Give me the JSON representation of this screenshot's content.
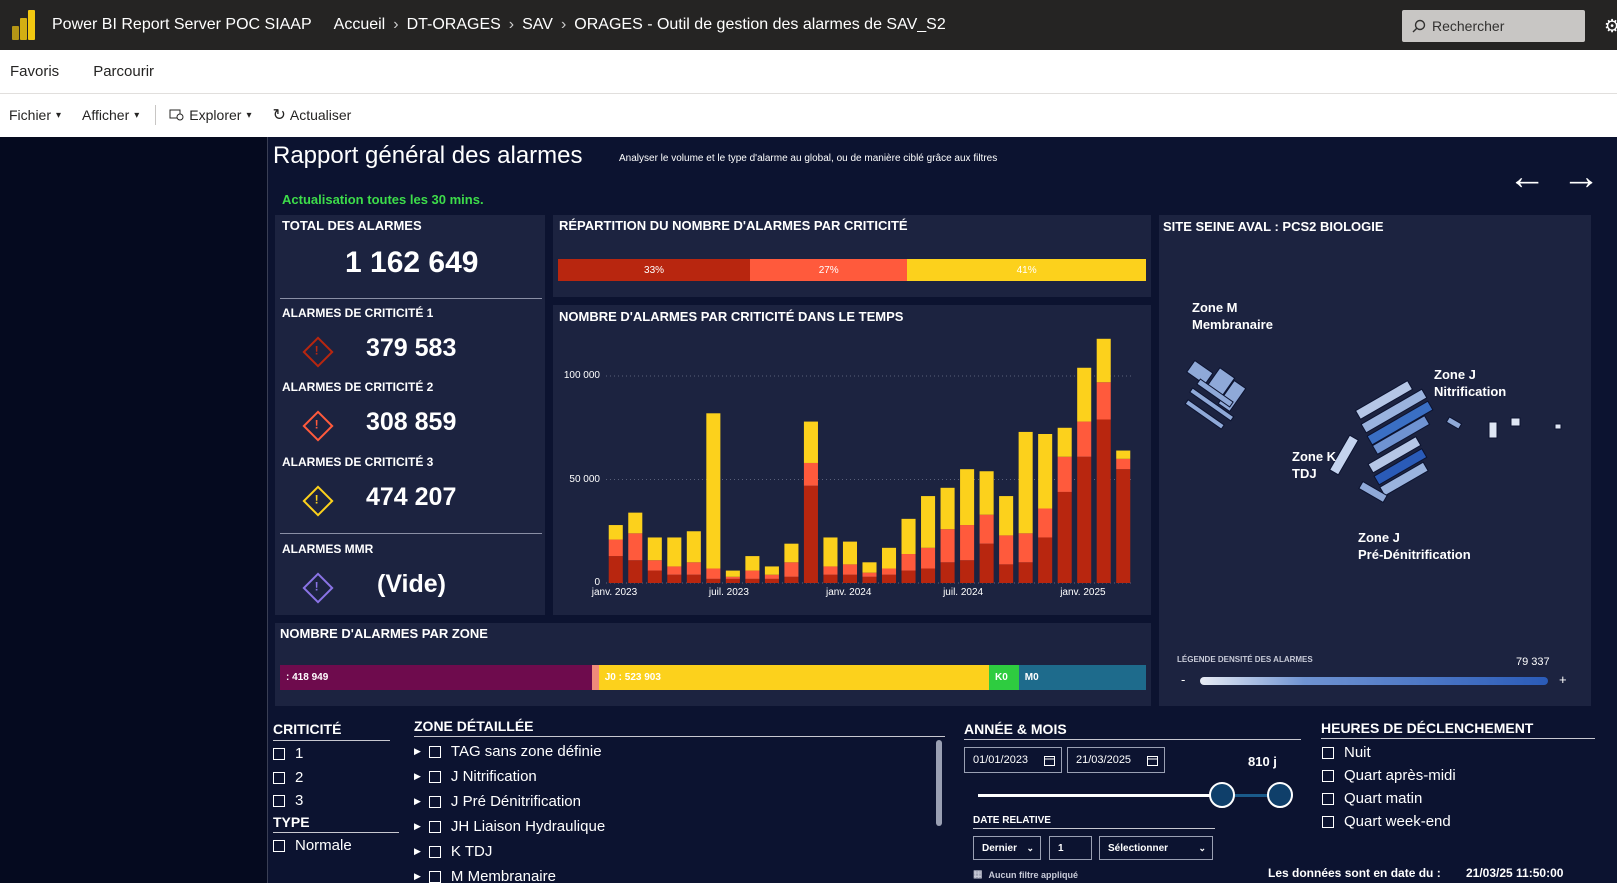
{
  "topbar": {
    "app_title": "Power BI Report Server POC SIAAP",
    "breadcrumbs": [
      "Accueil",
      "DT-ORAGES",
      "SAV",
      "ORAGES - Outil de gestion des alarmes de SAV_S2"
    ],
    "search_placeholder": "Rechercher"
  },
  "nav": {
    "favorites": "Favoris",
    "browse": "Parcourir"
  },
  "toolbar": {
    "file": "Fichier",
    "view": "Afficher",
    "explore": "Explorer",
    "refresh": "Actualiser"
  },
  "report": {
    "title": "Rapport général des alarmes",
    "subtitle": "Analyser le volume et le type d'alarme au global, ou de manière ciblé grâce aux filtres",
    "refresh_note": "Actualisation toutes les 30 mins.",
    "nav_prev": "←",
    "nav_next": "→"
  },
  "kpis": {
    "total_title": "TOTAL DES ALARMES",
    "total_value": "1 162 649",
    "crit1_title": "ALARMES DE CRITICITÉ 1",
    "crit1_value": "379 583",
    "crit2_title": "ALARMES DE CRITICITÉ 2",
    "crit2_value": "308 859",
    "crit3_title": "ALARMES DE CRITICITÉ 3",
    "crit3_value": "474 207",
    "mmr_title": "ALARMES MMR",
    "mmr_value": "(Vide)"
  },
  "colors": {
    "crit1": "#b8260f",
    "crit2": "#ff5a3c",
    "crit3": "#fcd11c",
    "mmr": "#8a73e6",
    "zone_a": "#6e0b4d",
    "zone_j": "#fcd11c",
    "zone_k": "#2ecc40",
    "zone_m": "#1e6b8c"
  },
  "repartition": {
    "title": "RÉPARTITION DU NOMBRE D'ALARMES PAR CRITICITÉ",
    "segments": [
      {
        "label": "33%",
        "value": 33,
        "color": "#b8260f"
      },
      {
        "label": "27%",
        "value": 27,
        "color": "#ff5a3c"
      },
      {
        "label": "41%",
        "value": 41,
        "color": "#fcd11c"
      }
    ]
  },
  "timeline": {
    "title": "NOMBRE D'ALARMES PAR CRITICITÉ DANS LE TEMPS"
  },
  "chart_data": {
    "type": "bar",
    "stacked": true,
    "title": "NOMBRE D'ALARMES PAR CRITICITÉ DANS LE TEMPS",
    "y_ticks": [
      "0",
      "50 000",
      "100 000"
    ],
    "x_tick_labels": [
      "janv. 2023",
      "juil. 2023",
      "janv. 2024",
      "juil. 2024",
      "janv. 2025"
    ],
    "ylim": [
      0,
      115000
    ],
    "grid": true,
    "categories": [
      "2023-01",
      "2023-02",
      "2023-03",
      "2023-04",
      "2023-05",
      "2023-06",
      "2023-07",
      "2023-08",
      "2023-09",
      "2023-10",
      "2023-11",
      "2023-12",
      "2024-01",
      "2024-02",
      "2024-03",
      "2024-04",
      "2024-05",
      "2024-06",
      "2024-07",
      "2024-08",
      "2024-09",
      "2024-10",
      "2024-11",
      "2024-12",
      "2025-01",
      "2025-02",
      "2025-03"
    ],
    "series": [
      {
        "values": [
          13000,
          11000,
          6000,
          4000,
          4000,
          2000,
          2000,
          2000,
          2000,
          3000,
          47000,
          4000,
          4000,
          3000,
          4000,
          6000,
          7000,
          10000,
          11000,
          19000,
          9000,
          10000,
          22000,
          44000,
          61000,
          79000,
          55000
        ],
        "color": "#b8260f"
      },
      {
        "values": [
          8000,
          13000,
          5000,
          4000,
          6000,
          5000,
          1000,
          4000,
          2000,
          7000,
          11000,
          4000,
          5000,
          2000,
          3000,
          8000,
          10000,
          16000,
          17000,
          14000,
          14000,
          14000,
          14000,
          17000,
          17000,
          18000,
          5000
        ],
        "color": "#ff5a3c"
      },
      {
        "values": [
          7000,
          10000,
          11000,
          14000,
          15000,
          75000,
          3000,
          7000,
          4000,
          9000,
          20000,
          14000,
          11000,
          5000,
          10000,
          17000,
          25000,
          20000,
          27000,
          21000,
          19000,
          49000,
          36000,
          14000,
          26000,
          21000,
          4000
        ],
        "color": "#fcd11c"
      }
    ]
  },
  "zones": {
    "title": "NOMBRE D'ALARMES PAR ZONE",
    "segments": [
      {
        "label": ": 418 949",
        "value": 418949,
        "color": "#6e0b4d"
      },
      {
        "label": "",
        "value": 9000,
        "color": "#f08a7a"
      },
      {
        "label": "J0 : 523 903",
        "value": 523903,
        "color": "#fcd11c"
      },
      {
        "label": "K0",
        "value": 40000,
        "color": "#2ecc40"
      },
      {
        "label": "M0",
        "value": 170797,
        "color": "#1e6b8c"
      }
    ]
  },
  "site": {
    "title": "SITE SEINE AVAL : PCS2 BIOLOGIE",
    "zone_m": [
      "Zone M",
      "Membranaire"
    ],
    "zone_j_nit": [
      "Zone J",
      "Nitrification"
    ],
    "zone_k": [
      "Zone K",
      "TDJ"
    ],
    "zone_j_pre": [
      "Zone J",
      "Pré-Dénitrification"
    ],
    "legend_title": "LÉGENDE DENSITÉ DES ALARMES",
    "legend_max": "79 337",
    "legend_minus": "-",
    "legend_plus": "+"
  },
  "filters": {
    "criticite_title": "CRITICITÉ",
    "criticite": [
      "1",
      "2",
      "3"
    ],
    "type_title": "TYPE",
    "type": [
      "Normale"
    ],
    "zone_title": "ZONE DÉTAILLÉE",
    "zone_items": [
      "TAG sans zone définie",
      "J Nitrification",
      "J Pré Dénitrification",
      "JH Liaison Hydraulique",
      "K TDJ",
      "M Membranaire"
    ],
    "annee_title": "ANNÉE & MOIS",
    "date_start": "01/01/2023",
    "date_end": "21/03/2025",
    "duration": "810 j",
    "date_rel_title": "DATE RELATIVE",
    "rel_mode": "Dernier",
    "rel_count": "1",
    "rel_unit": "Sélectionner",
    "no_filter": "Aucun filtre appliqué",
    "slider_start": 0.8,
    "heures_title": "HEURES DE DÉCLENCHEMENT",
    "heures": [
      "Nuit",
      "Quart après-midi",
      "Quart matin",
      "Quart week-end"
    ],
    "data_date_label": "Les données sont en date du :",
    "data_date_value": "21/03/25 11:50:00"
  }
}
